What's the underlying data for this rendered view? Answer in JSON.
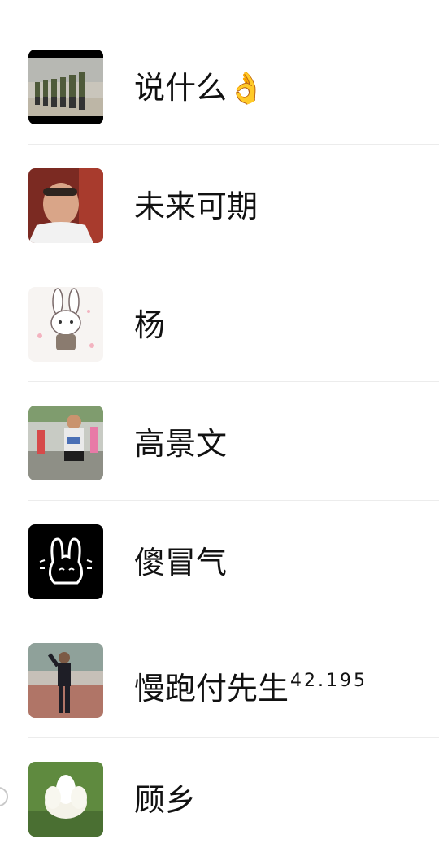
{
  "contacts": [
    {
      "name": "说什么",
      "emoji": "👌",
      "avatar_icon": "soldiers-parade-photo"
    },
    {
      "name": "未来可期",
      "avatar_icon": "smiling-man-photo"
    },
    {
      "name": "杨",
      "avatar_icon": "cartoon-rabbit-illustration"
    },
    {
      "name": "高景文",
      "avatar_icon": "marathon-runner-photo"
    },
    {
      "name": "傻冒气",
      "avatar_icon": "bunny-doodle-icon"
    },
    {
      "name": "慢跑付先生",
      "suffix": "42.195",
      "avatar_icon": "man-in-sportswear-photo"
    },
    {
      "name": "顾乡",
      "avatar_icon": "white-lotus-photo"
    }
  ]
}
